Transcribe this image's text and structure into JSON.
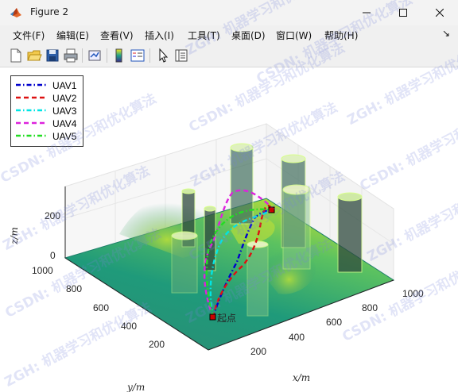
{
  "window": {
    "title": "Figure 2",
    "minimize_label": "—",
    "maximize_label": "☐",
    "close_label": "✕"
  },
  "menu": [
    {
      "label": "文件(F)"
    },
    {
      "label": "编辑(E)"
    },
    {
      "label": "查看(V)"
    },
    {
      "label": "插入(I)"
    },
    {
      "label": "工具(T)"
    },
    {
      "label": "桌面(D)"
    },
    {
      "label": "窗口(W)"
    },
    {
      "label": "帮助(H)"
    }
  ],
  "toolbar": {
    "icons": [
      "new-figure-icon",
      "open-folder-icon",
      "save-icon",
      "print-icon",
      "link-plot-icon",
      "colorbar-icon",
      "legend-icon",
      "pointer-icon",
      "property-inspector-icon"
    ],
    "dock_label": "↘"
  },
  "plot": {
    "xlabel": "x/m",
    "ylabel": "y/m",
    "zlabel": "z/m",
    "x_ticks": [
      "200",
      "400",
      "600",
      "800",
      "1000"
    ],
    "y_ticks": [
      "200",
      "400",
      "600",
      "800",
      "1000"
    ],
    "z_ticks": [
      "0",
      "200"
    ],
    "start_label": "起点",
    "legend": [
      {
        "name": "UAV1",
        "color": "#0000cc",
        "style": "dashdot"
      },
      {
        "name": "UAV2",
        "color": "#dd1111",
        "style": "dashed"
      },
      {
        "name": "UAV3",
        "color": "#00e5e5",
        "style": "dashdot"
      },
      {
        "name": "UAV4",
        "color": "#dd22dd",
        "style": "dashed"
      },
      {
        "name": "UAV5",
        "color": "#22dd22",
        "style": "dashdot"
      }
    ]
  },
  "watermarks": {
    "a": "ZGH: 机器学习和优化算法",
    "b": "CSDN: 机器学习和优化算法"
  }
}
